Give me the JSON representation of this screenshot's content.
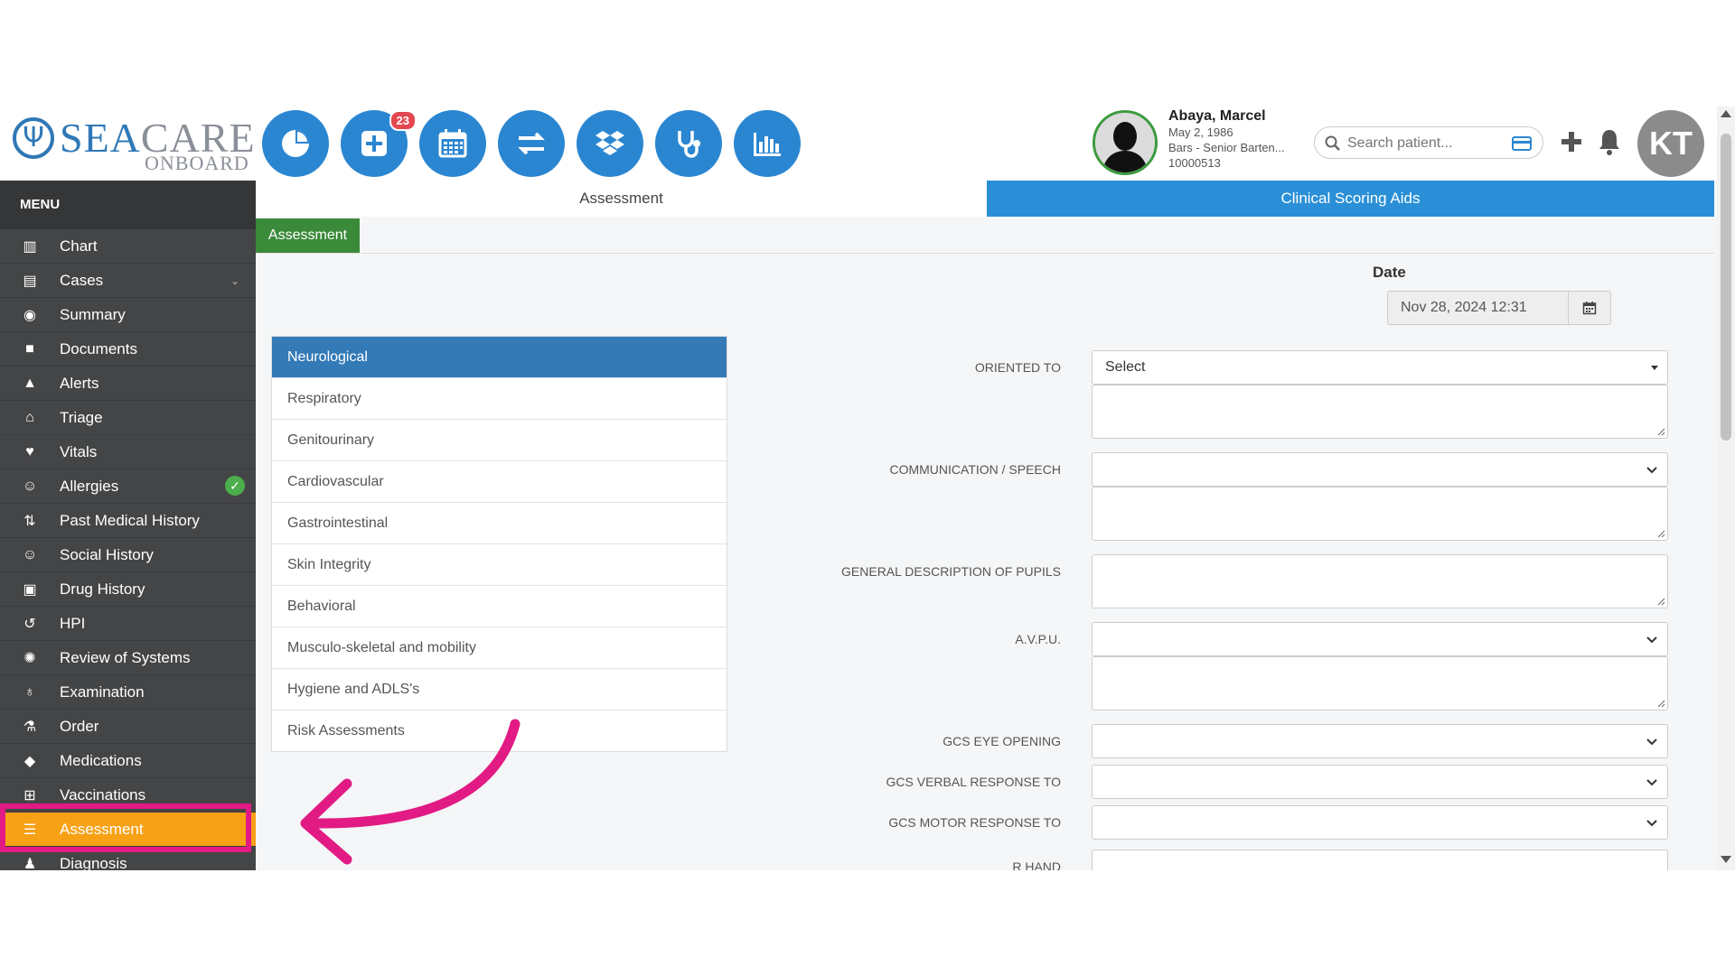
{
  "brand": {
    "name_part1": "SEA",
    "name_part2": "CARE",
    "tagline": "ONBOARD",
    "trident": "Ψ"
  },
  "header": {
    "icons": [
      "pie-chart-icon",
      "plus-square-icon",
      "calendar-icon",
      "transfer-icon",
      "dropbox-icon",
      "stethoscope-icon",
      "bar-chart-icon"
    ],
    "notification_badge": "23",
    "patient": {
      "name": "Abaya, Marcel",
      "dob": "May 2, 1986",
      "role": "Bars - Senior Barten...",
      "id": "10000513"
    },
    "search": {
      "placeholder": "Search patient..."
    },
    "user_initials": "KT"
  },
  "sidebar": {
    "title": "MENU",
    "items": [
      {
        "label": "Chart",
        "icon": "bar-chart-icon"
      },
      {
        "label": "Cases",
        "icon": "archive-icon"
      },
      {
        "label": "Summary",
        "icon": "eye-icon"
      },
      {
        "label": "Documents",
        "icon": "folder-icon"
      },
      {
        "label": "Alerts",
        "icon": "warning-icon"
      },
      {
        "label": "Triage",
        "icon": "inbox-icon"
      },
      {
        "label": "Vitals",
        "icon": "heart-icon"
      },
      {
        "label": "Allergies",
        "icon": "smile-icon"
      },
      {
        "label": "Past Medical History",
        "icon": "sort-icon"
      },
      {
        "label": "Social History",
        "icon": "smile-icon"
      },
      {
        "label": "Drug History",
        "icon": "medkit-icon"
      },
      {
        "label": "HPI",
        "icon": "history-icon"
      },
      {
        "label": "Review of Systems",
        "icon": "gear-icon"
      },
      {
        "label": "Examination",
        "icon": "stethoscope-icon"
      },
      {
        "label": "Order",
        "icon": "flask-icon"
      },
      {
        "label": "Medications",
        "icon": "pill-icon"
      },
      {
        "label": "Vaccinations",
        "icon": "plus-square-icon"
      },
      {
        "label": "Assessment",
        "icon": "list-icon"
      },
      {
        "label": "Diagnosis",
        "icon": "user-md-icon"
      }
    ]
  },
  "tabs": {
    "assessment": "Assessment",
    "clinical_scoring": "Clinical Scoring Aids",
    "subtab": "Assessment"
  },
  "date": {
    "label": "Date",
    "value": "Nov 28, 2024 12:31"
  },
  "systems": [
    "Neurological",
    "Respiratory",
    "Genitourinary",
    "Cardiovascular",
    "Gastrointestinal",
    "Skin Integrity",
    "Behavioral",
    "Musculo-skeletal and mobility",
    "Hygiene and ADLS's",
    "Risk Assessments"
  ],
  "fields": {
    "oriented_to": {
      "label": "ORIENTED TO",
      "value": "Select"
    },
    "communication": {
      "label": "COMMUNICATION / SPEECH"
    },
    "pupils": {
      "label": "GENERAL DESCRIPTION OF PUPILS"
    },
    "avpu": {
      "label": "A.V.P.U."
    },
    "gcs_eye": {
      "label": "GCS EYE OPENING"
    },
    "gcs_verbal": {
      "label": "GCS VERBAL RESPONSE TO"
    },
    "gcs_motor": {
      "label": "GCS MOTOR RESPONSE TO"
    },
    "r_hand": {
      "label": "R HAND"
    }
  },
  "colors": {
    "brand_blue": "#2b86d1",
    "active_orange": "#f7a116",
    "highlight_pink": "#e21a84",
    "sidebar_bg": "#444546",
    "subtab_green": "#3a8a3a"
  }
}
